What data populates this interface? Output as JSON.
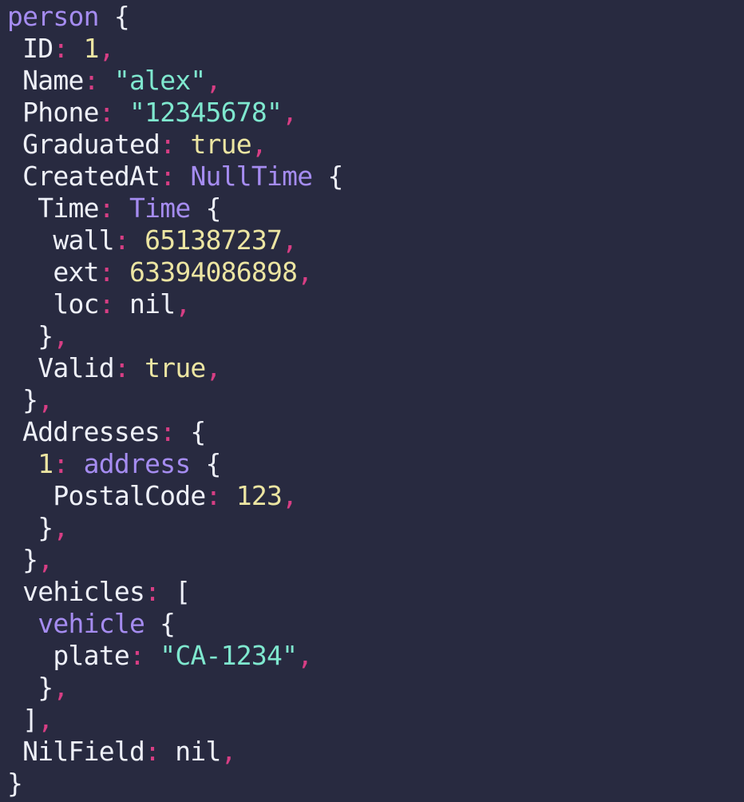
{
  "theme": {
    "background": "#282a40",
    "text": "#eef0f8",
    "type": "#a58cf0",
    "punct": "#d73e84",
    "number": "#ece5a2",
    "string": "#7fe8cf",
    "bool": "#ece5a2"
  },
  "lines": [
    [
      {
        "t": "type",
        "v": "person"
      },
      {
        "t": "text",
        "v": " {"
      }
    ],
    [
      {
        "t": "key",
        "v": " ID"
      },
      {
        "t": "punct",
        "v": ":"
      },
      {
        "t": "text",
        "v": " "
      },
      {
        "t": "num",
        "v": "1"
      },
      {
        "t": "punct",
        "v": ","
      }
    ],
    [
      {
        "t": "key",
        "v": " Name"
      },
      {
        "t": "punct",
        "v": ":"
      },
      {
        "t": "text",
        "v": " "
      },
      {
        "t": "str",
        "v": "\"alex\""
      },
      {
        "t": "punct",
        "v": ","
      }
    ],
    [
      {
        "t": "key",
        "v": " Phone"
      },
      {
        "t": "punct",
        "v": ":"
      },
      {
        "t": "text",
        "v": " "
      },
      {
        "t": "str",
        "v": "\"12345678\""
      },
      {
        "t": "punct",
        "v": ","
      }
    ],
    [
      {
        "t": "key",
        "v": " Graduated"
      },
      {
        "t": "punct",
        "v": ":"
      },
      {
        "t": "text",
        "v": " "
      },
      {
        "t": "kw",
        "v": "true"
      },
      {
        "t": "punct",
        "v": ","
      }
    ],
    [
      {
        "t": "key",
        "v": " CreatedAt"
      },
      {
        "t": "punct",
        "v": ":"
      },
      {
        "t": "text",
        "v": " "
      },
      {
        "t": "type",
        "v": "NullTime"
      },
      {
        "t": "text",
        "v": " {"
      }
    ],
    [
      {
        "t": "key",
        "v": "  Time"
      },
      {
        "t": "punct",
        "v": ":"
      },
      {
        "t": "text",
        "v": " "
      },
      {
        "t": "type",
        "v": "Time"
      },
      {
        "t": "text",
        "v": " {"
      }
    ],
    [
      {
        "t": "key",
        "v": "   wall"
      },
      {
        "t": "punct",
        "v": ":"
      },
      {
        "t": "text",
        "v": " "
      },
      {
        "t": "num",
        "v": "651387237"
      },
      {
        "t": "punct",
        "v": ","
      }
    ],
    [
      {
        "t": "key",
        "v": "   ext"
      },
      {
        "t": "punct",
        "v": ":"
      },
      {
        "t": "text",
        "v": " "
      },
      {
        "t": "num",
        "v": "63394086898"
      },
      {
        "t": "punct",
        "v": ","
      }
    ],
    [
      {
        "t": "key",
        "v": "   loc"
      },
      {
        "t": "punct",
        "v": ":"
      },
      {
        "t": "text",
        "v": " nil"
      },
      {
        "t": "punct",
        "v": ","
      }
    ],
    [
      {
        "t": "text",
        "v": "  }"
      },
      {
        "t": "punct",
        "v": ","
      }
    ],
    [
      {
        "t": "key",
        "v": "  Valid"
      },
      {
        "t": "punct",
        "v": ":"
      },
      {
        "t": "text",
        "v": " "
      },
      {
        "t": "kw",
        "v": "true"
      },
      {
        "t": "punct",
        "v": ","
      }
    ],
    [
      {
        "t": "text",
        "v": " }"
      },
      {
        "t": "punct",
        "v": ","
      }
    ],
    [
      {
        "t": "key",
        "v": " Addresses"
      },
      {
        "t": "punct",
        "v": ":"
      },
      {
        "t": "text",
        "v": " {"
      }
    ],
    [
      {
        "t": "num",
        "v": "  1"
      },
      {
        "t": "punct",
        "v": ":"
      },
      {
        "t": "text",
        "v": " "
      },
      {
        "t": "type",
        "v": "address"
      },
      {
        "t": "text",
        "v": " {"
      }
    ],
    [
      {
        "t": "key",
        "v": "   PostalCode"
      },
      {
        "t": "punct",
        "v": ":"
      },
      {
        "t": "text",
        "v": " "
      },
      {
        "t": "num",
        "v": "123"
      },
      {
        "t": "punct",
        "v": ","
      }
    ],
    [
      {
        "t": "text",
        "v": "  }"
      },
      {
        "t": "punct",
        "v": ","
      }
    ],
    [
      {
        "t": "text",
        "v": " }"
      },
      {
        "t": "punct",
        "v": ","
      }
    ],
    [
      {
        "t": "key",
        "v": " vehicles"
      },
      {
        "t": "punct",
        "v": ":"
      },
      {
        "t": "text",
        "v": " ["
      }
    ],
    [
      {
        "t": "type",
        "v": "  vehicle"
      },
      {
        "t": "text",
        "v": " {"
      }
    ],
    [
      {
        "t": "key",
        "v": "   plate"
      },
      {
        "t": "punct",
        "v": ":"
      },
      {
        "t": "text",
        "v": " "
      },
      {
        "t": "str",
        "v": "\"CA-1234\""
      },
      {
        "t": "punct",
        "v": ","
      }
    ],
    [
      {
        "t": "text",
        "v": "  }"
      },
      {
        "t": "punct",
        "v": ","
      }
    ],
    [
      {
        "t": "text",
        "v": " ]"
      },
      {
        "t": "punct",
        "v": ","
      }
    ],
    [
      {
        "t": "key",
        "v": " NilField"
      },
      {
        "t": "punct",
        "v": ":"
      },
      {
        "t": "text",
        "v": " nil"
      },
      {
        "t": "punct",
        "v": ","
      }
    ],
    [
      {
        "t": "text",
        "v": "}"
      }
    ]
  ]
}
